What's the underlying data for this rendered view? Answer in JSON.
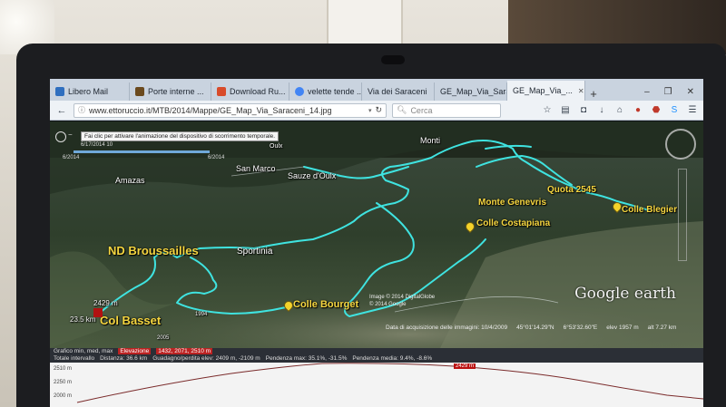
{
  "browser": {
    "tabs": [
      {
        "label": "Libero Mail",
        "color": "#2f6fbf"
      },
      {
        "label": "Porte interne ...",
        "color": "#6b4a1e"
      },
      {
        "label": "Download Ru...",
        "color": "#d84b2a"
      },
      {
        "label": "velette tende ...",
        "color": "#4285f4"
      },
      {
        "label": "Via dei Saraceni",
        "color": "#888888"
      },
      {
        "label": "GE_Map_Via_Sara...",
        "color": "#888888"
      },
      {
        "label": "GE_Map_Via_...",
        "color": "#888888",
        "active": true
      }
    ],
    "new_tab": "+",
    "url": "www.ettoruccio.it/MTB/2014/Mappe/GE_Map_Via_Saraceni_14.jpg",
    "search_placeholder": "Cerca"
  },
  "map": {
    "tooltip": "Fai clic per attivare l'animazione del dispositivo di scorrimento temporale.",
    "slider_date": "6/17/2014  10",
    "slider_left": "6/2014",
    "slider_right": "6/2014",
    "labels": {
      "monti": "Monti",
      "quota": "Quota 2545",
      "monte_genevris": "Monte Genevris",
      "colle_blegier": "Colle Blegier",
      "colle_costapiana": "Colle Costapiana",
      "sauze": "Sauze d'Oulx",
      "san_marco": "San Marco",
      "amazas": "Amazas",
      "oulx": "Oulx",
      "nd_broussailles": "ND Broussailles",
      "sportinia": "Sportinia",
      "colle_bourget": "Colle Bourget",
      "col_basset": "Col Basset",
      "elev_2429": "2429 m",
      "dist_235": "23.5 km",
      "tick_1994": "1994",
      "year_2005": "2005"
    },
    "copyright": [
      "Image © 2014 DigitalGlobe",
      "© 2014 Google"
    ],
    "brand": "Google earth",
    "status": {
      "acquisition": "Data di acquisizione delle immagini: 10/4/2009",
      "lat": "45°01'14.29\"N",
      "lon": "6°53'32.60\"E",
      "elev": "elev 1957 m",
      "alt": "alt 7.27 km"
    }
  },
  "profile": {
    "row1": {
      "label": "Grafico min, med, max",
      "key": "Elevazione",
      "value": "1432, 2071, 2510 m"
    },
    "row2": {
      "label": "Totale intervallo",
      "distance": "Distanza: 36.6 km",
      "gain": "Guadagno/perdita elev: 2409 m, -2109 m",
      "slope": "Pendenza max: 35.1%, -31.5%",
      "avg": "Pendenza media: 9.4%, -8.6%"
    },
    "marker": "2429 m",
    "yticks": [
      "2510 m",
      "2250 m",
      "2000 m"
    ]
  },
  "colors": {
    "track": "#3fe3e0",
    "labels": "#f6d640",
    "marker": "#b11111"
  }
}
